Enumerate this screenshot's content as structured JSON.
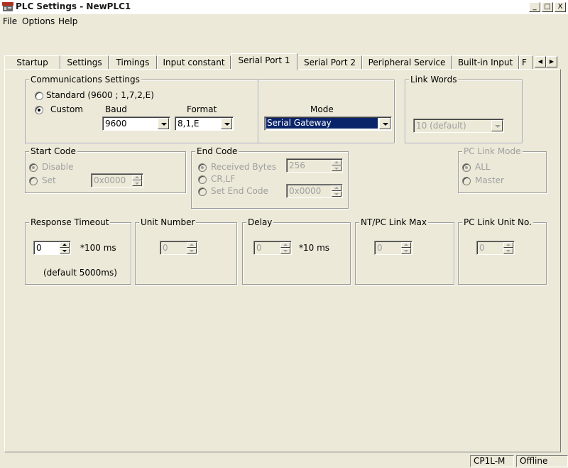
{
  "window": {
    "title": "PLC Settings - NewPLC1",
    "minimize_glyph": "_",
    "maximize_glyph": "□",
    "close_glyph": "X"
  },
  "menu": [
    "File",
    "Options",
    "Help"
  ],
  "tabs": [
    {
      "label": "Startup"
    },
    {
      "label": "Settings"
    },
    {
      "label": "Timings"
    },
    {
      "label": "Input constant"
    },
    {
      "label": "Serial Port 1",
      "active": true
    },
    {
      "label": "Serial Port 2"
    },
    {
      "label": "Peripheral Service"
    },
    {
      "label": "Built-in Input"
    },
    {
      "label": "F"
    }
  ],
  "tab_scroll": {
    "left": "◀",
    "right": "▶"
  },
  "comm": {
    "legend": "Communications Settings",
    "standard_label": "Standard (9600 ; 1,7,2,E)",
    "custom_label": "Custom",
    "selected": "Custom",
    "baud_label": "Baud",
    "baud_value": "9600",
    "format_label": "Format",
    "format_value": "8,1,E",
    "mode_label": "Mode",
    "mode_value": "Serial Gateway"
  },
  "link_words": {
    "legend": "Link Words",
    "value": "10 (default)"
  },
  "start_code": {
    "legend": "Start Code",
    "disable_label": "Disable",
    "set_label": "Set",
    "selected": "Disable",
    "value": "0x0000"
  },
  "end_code": {
    "legend": "End Code",
    "received_label": "Received Bytes",
    "received_value": "256",
    "crlf_label": "CR,LF",
    "set_label": "Set End Code",
    "set_value": "0x0000",
    "selected": "Received Bytes"
  },
  "pc_link_mode": {
    "legend": "PC Link Mode",
    "all_label": "ALL",
    "master_label": "Master",
    "selected": "ALL"
  },
  "response_timeout": {
    "legend": "Response Timeout",
    "value": "0",
    "unit": "*100 ms",
    "note": "(default 5000ms)"
  },
  "unit_number": {
    "legend": "Unit Number",
    "value": "0"
  },
  "delay": {
    "legend": "Delay",
    "value": "0",
    "unit": "*10 ms"
  },
  "nt_pc_link_max": {
    "legend": "NT/PC Link Max",
    "value": "0"
  },
  "pc_link_unit_no": {
    "legend": "PC Link Unit No.",
    "value": "0"
  },
  "status": {
    "model": "CP1L-M",
    "state": "Offline"
  },
  "colors": {
    "selection": "#0a246a",
    "face": "#ece9d8",
    "disabled_text": "#a0a0a0"
  }
}
